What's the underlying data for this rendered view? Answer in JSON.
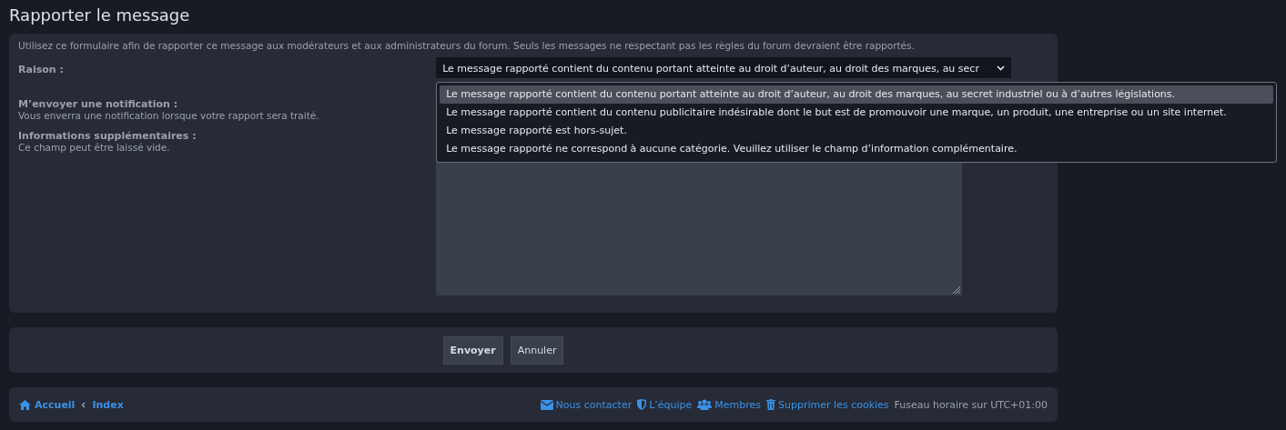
{
  "page_title": "Rapporter le message",
  "form": {
    "intro": "Utilisez ce formulaire afin de rapporter ce message aux modérateurs et aux administrateurs du forum. Seuls les messages ne respectant pas les règles du forum devraient être rapportés.",
    "fields": [
      {
        "kind": "select",
        "label": "Raison :",
        "value": "Le message rapporté contient du contenu portant atteinte au droit d’auteur, au droit des marques, au secr",
        "expanded": true,
        "options": [
          {
            "label": "Le message rapporté contient du contenu portant atteinte au droit d’auteur, au droit des marques, au secret industriel ou à d’autres législations.",
            "selected": true
          },
          {
            "label": "Le message rapporté contient du contenu publicitaire indésirable dont le but est de promouvoir une marque, un produit, une entreprise ou un site internet.",
            "selected": false
          },
          {
            "label": "Le message rapporté est hors-sujet.",
            "selected": false
          },
          {
            "label": "Le message rapporté ne correspond à aucune catégorie. Veuillez utiliser le champ d’information complémentaire.",
            "selected": false
          }
        ]
      },
      {
        "kind": "notify",
        "label": "M’envoyer une notification :",
        "hint": "Vous enverra une notification lorsque votre rapport sera traité."
      },
      {
        "kind": "textarea",
        "label": "Informations supplémentaires :",
        "hint": "Ce champ peut être laissé vide."
      }
    ]
  },
  "buttons": [
    {
      "label": "Envoyer",
      "primary": true
    },
    {
      "label": "Annuler",
      "primary": false
    }
  ],
  "footer": {
    "breadcrumbs": [
      "Accueil",
      "Index"
    ],
    "links": [
      {
        "label": "Nous contacter"
      },
      {
        "label": "L’équipe"
      },
      {
        "label": "Membres"
      },
      {
        "label": "Supprimer les cookies"
      }
    ],
    "timezone": "Fuseau horaire sur UTC+01:00"
  }
}
